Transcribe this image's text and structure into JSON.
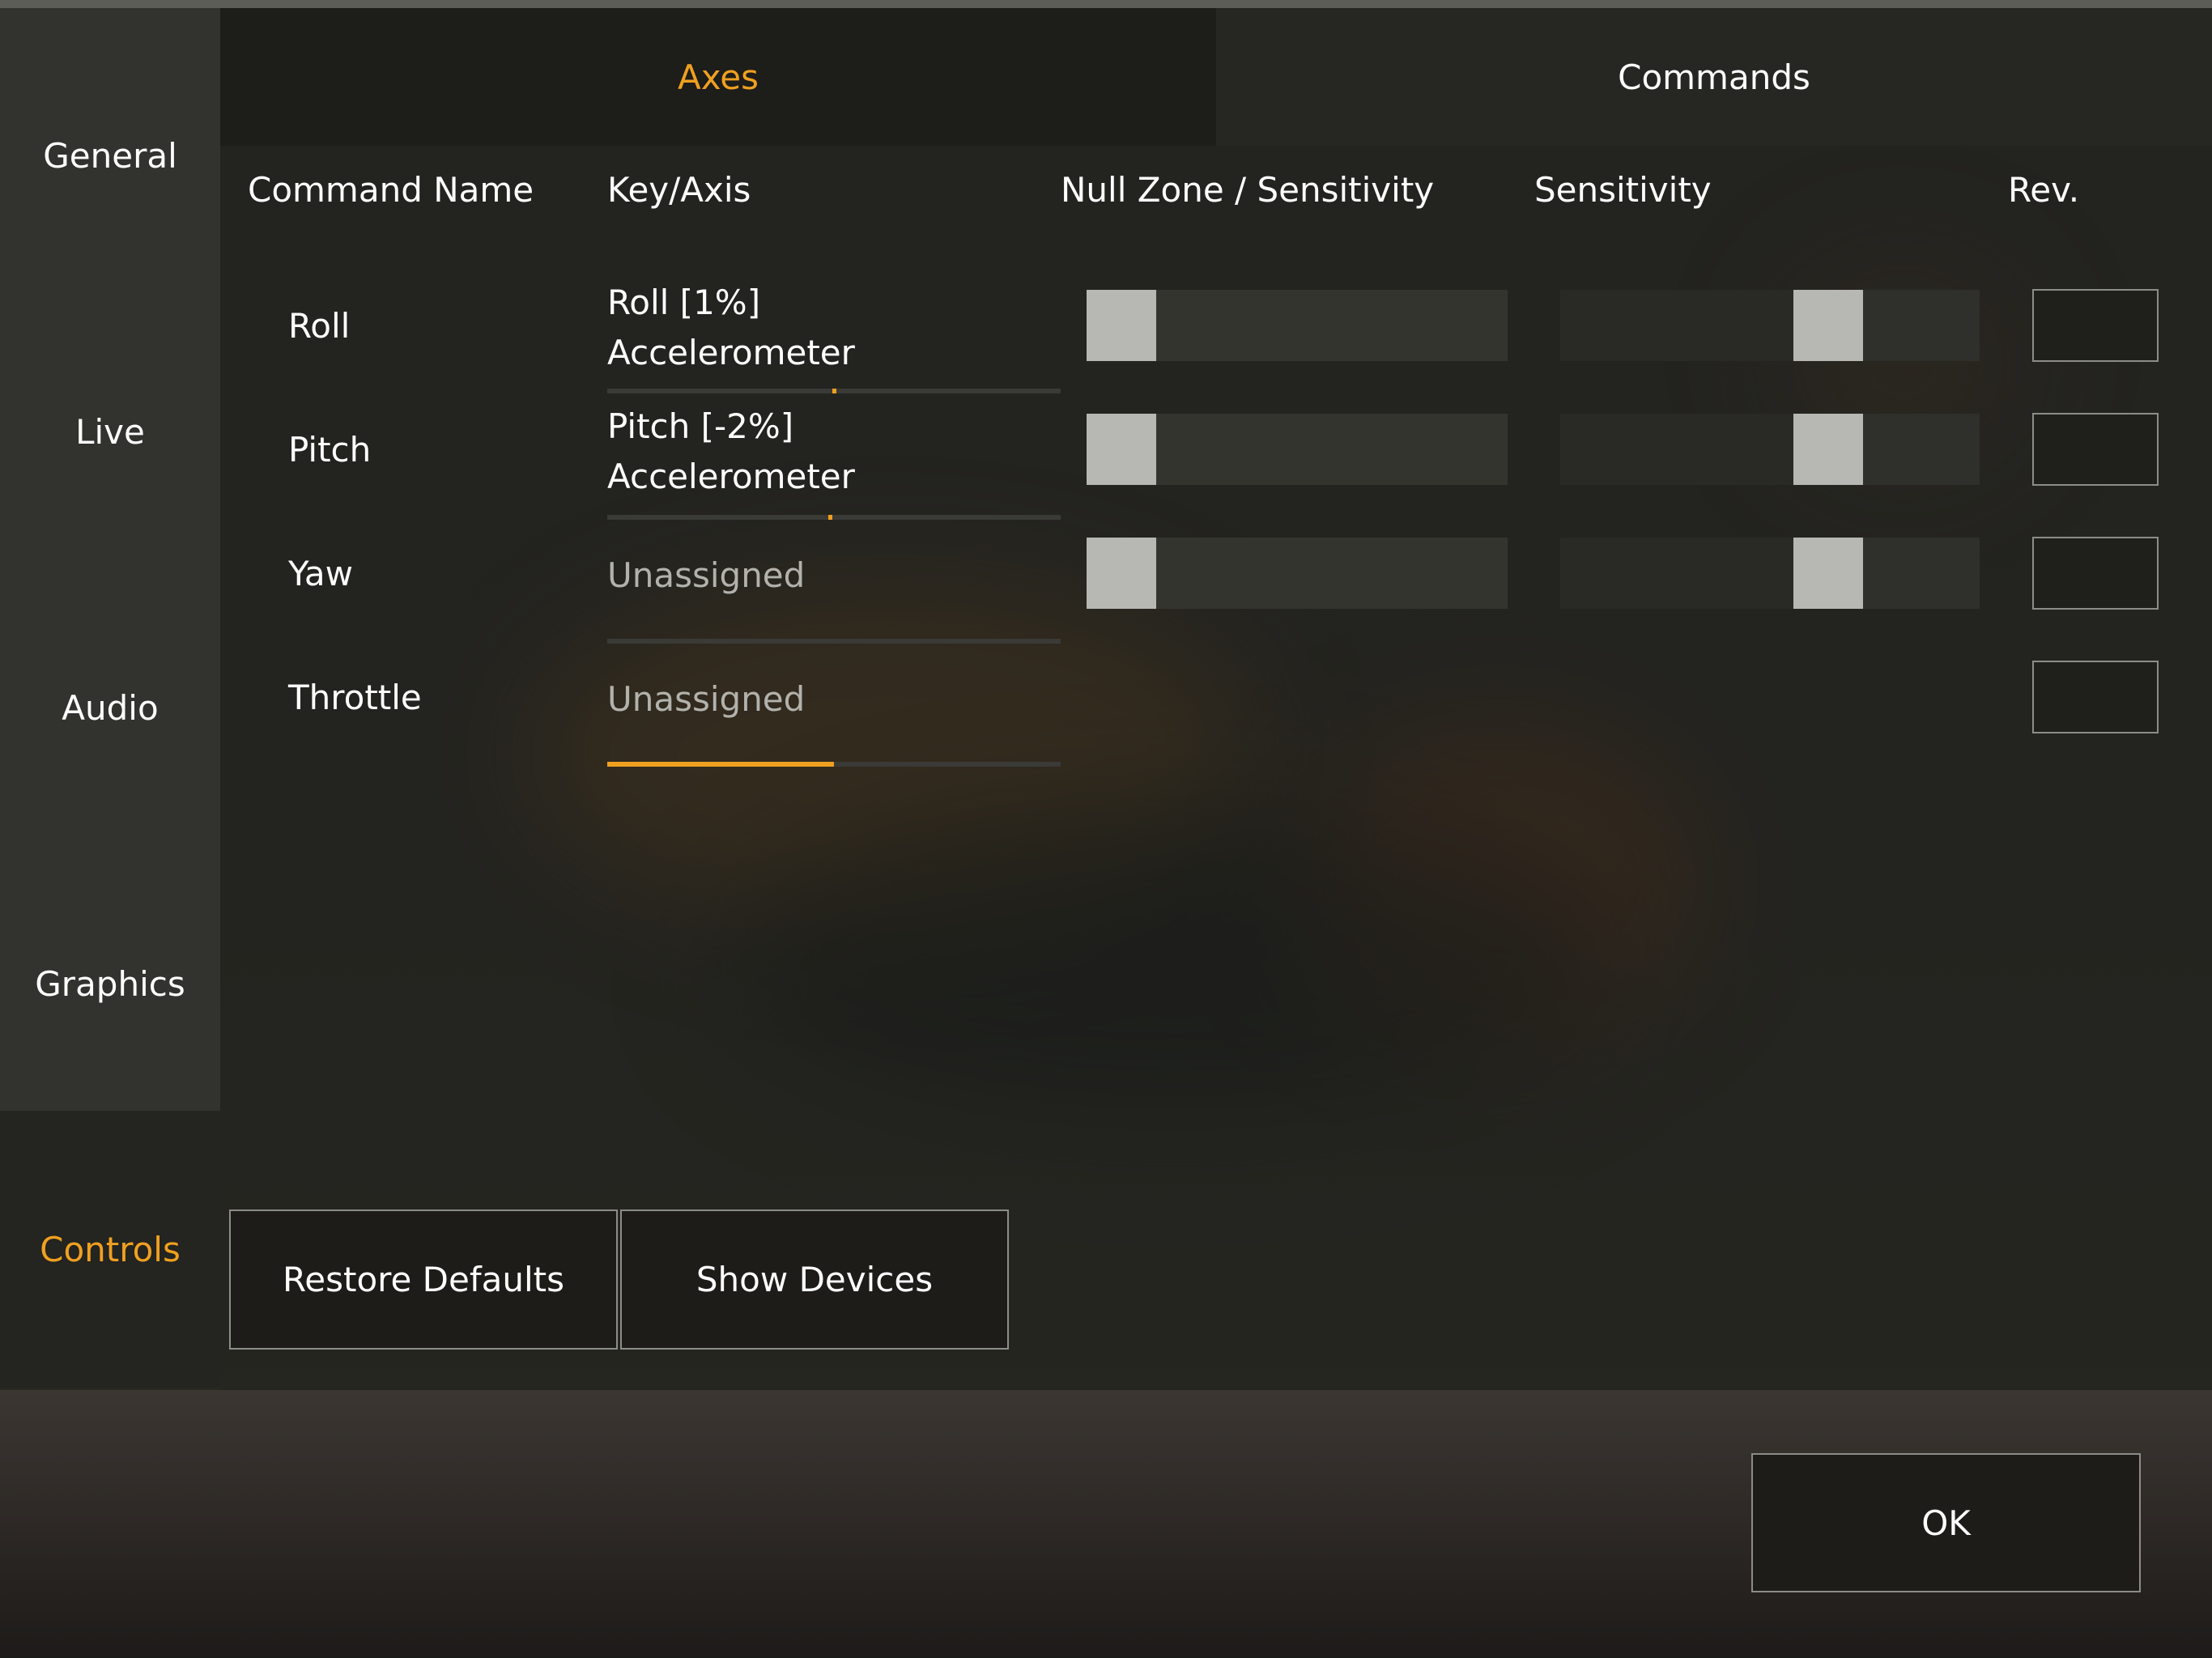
{
  "sidebar": {
    "items": [
      {
        "label": "General",
        "active": false
      },
      {
        "label": "Live",
        "active": false
      },
      {
        "label": "Audio",
        "active": false
      },
      {
        "label": "Graphics",
        "active": false
      },
      {
        "label": "Controls",
        "active": true
      }
    ]
  },
  "tabs": [
    {
      "label": "Axes",
      "active": true
    },
    {
      "label": "Commands",
      "active": false
    }
  ],
  "table": {
    "headers": {
      "command_name": "Command Name",
      "key_axis": "Key/Axis",
      "null_zone": "Null Zone / Sensitivity",
      "sensitivity": "Sensitivity",
      "rev": "Rev."
    },
    "rows": [
      {
        "name": "Roll",
        "axis_line1": "Roll [1%]",
        "axis_line2": "Accelerometer",
        "assigned": true,
        "axis_value": 0.5,
        "null_zone": 0.0,
        "sensitivity": 0.62,
        "reversed": false
      },
      {
        "name": "Pitch",
        "axis_line1": "Pitch [-2%]",
        "axis_line2": "Accelerometer",
        "assigned": true,
        "axis_value": 0.49,
        "null_zone": 0.0,
        "sensitivity": 0.62,
        "reversed": false
      },
      {
        "name": "Yaw",
        "axis_line1": "Unassigned",
        "axis_line2": "",
        "assigned": false,
        "axis_value": 0.0,
        "null_zone": 0.0,
        "sensitivity": 0.62,
        "reversed": false
      },
      {
        "name": "Throttle",
        "axis_line1": "Unassigned",
        "axis_line2": "",
        "assigned": false,
        "axis_value": 0.5,
        "reversed": false
      }
    ]
  },
  "buttons": {
    "restore_defaults": "Restore Defaults",
    "show_devices": "Show Devices",
    "ok": "OK"
  },
  "colors": {
    "accent": "#f0a020",
    "thumb": "#b7b7b4"
  }
}
